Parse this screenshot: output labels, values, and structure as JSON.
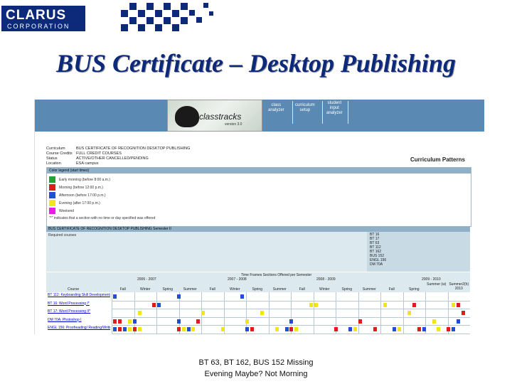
{
  "header": {
    "logo_main": "CLARUS",
    "logo_sub": "CORPORATION",
    "slide_title": "BUS Certificate – Desktop Publishing"
  },
  "app": {
    "logo_word": "classtracks",
    "logo_version": "version 3.0",
    "nav": [
      {
        "line1": "class",
        "line2": "analyzer"
      },
      {
        "line1": "curriculum",
        "line2": "setup"
      },
      {
        "line1": "student",
        "line2": "input",
        "line3": "analyzer"
      }
    ],
    "info": {
      "curriculum_label": "Curriculum",
      "curriculum_value": "BUS CERTIFICATE OF RECOGNITION DESKTOP PUBLISHING",
      "credits_label": "Course Credits",
      "credits_value": "FULL CREDIT COURSES",
      "status_label": "Status",
      "status_value": "ACTIVE/OTHER CANCELLED/PENDING",
      "location_label": "Location",
      "location_value": "ESA campus"
    },
    "patterns_title": "Curriculum Patterns",
    "legend": {
      "header": "Color legend (start times)",
      "items": [
        {
          "label": "Early morning (before 8:00 a.m.)",
          "color": "#22a33a"
        },
        {
          "label": "Morning (before 12:00 p.m.)",
          "color": "#e01b1b"
        },
        {
          "label": "Afternoon (before 17:00 p.m.)",
          "color": "#1f4fd6"
        },
        {
          "label": "Evening (after 17:00 p.m.)",
          "color": "#f2e51b"
        },
        {
          "label": "Weekend",
          "color": "#e61ee6"
        }
      ],
      "note": "\"*\" indicates that a section with no time or day specified was offered"
    },
    "program_bar": "BUS CERTIFICATE OF RECOGNITION DESKTOP PUBLISHING Semester II",
    "required_label": "Required courses",
    "required_courses": [
      "BT 16",
      "BT 17",
      "BT 63",
      "BT 112",
      "BT 162",
      "BUS 152",
      "ENGL 156",
      "DM 70A"
    ],
    "schedule": {
      "time_frame_label": "Time Frames Sections Offered per Semester",
      "years": [
        "2006 - 2007",
        "2007 - 2008",
        "2008 - 2009",
        "2009 - 2010"
      ],
      "course_col": "Course",
      "terms": [
        "Fall",
        "Winter",
        "Spring",
        "Summer",
        "Fall",
        "Winter",
        "Spring",
        "Summer",
        "Fall",
        "Winter",
        "Spring",
        "Summer",
        "Fall",
        "Spring",
        "Summer (w)",
        "Summer2(h) 2010"
      ],
      "courses": [
        "BT 112: Keyboarding Skill Development",
        "BT 16: Word Processing I*",
        "BT 17: Word Processing II*",
        "DM 70A: Photoshop I",
        "ENGL 156: Proofreading/ Reading/Writing*"
      ],
      "cells": [
        [
          [
            0,
            "blue"
          ],
          [
            13,
            "blue"
          ],
          [
            26,
            "blue"
          ]
        ],
        [
          [
            8,
            "red"
          ],
          [
            9,
            "blue"
          ],
          [
            40,
            "yellow"
          ],
          [
            41,
            "yellow"
          ],
          [
            55,
            "yellow"
          ],
          [
            61,
            "red"
          ],
          [
            69,
            "yellow"
          ],
          [
            70,
            "red"
          ]
        ],
        [
          [
            5,
            "yellow"
          ],
          [
            18,
            "yellow"
          ],
          [
            30,
            "yellow"
          ],
          [
            60,
            "yellow"
          ],
          [
            71,
            "red"
          ]
        ],
        [
          [
            0,
            "red"
          ],
          [
            1,
            "red"
          ],
          [
            3,
            "yellow"
          ],
          [
            4,
            "blue"
          ],
          [
            13,
            "blue"
          ],
          [
            17,
            "red"
          ],
          [
            27,
            "yellow"
          ],
          [
            36,
            "blue"
          ],
          [
            50,
            "red"
          ],
          [
            65,
            "yellow"
          ],
          [
            70,
            "blue"
          ]
        ],
        [
          [
            0,
            "blue"
          ],
          [
            1,
            "red"
          ],
          [
            2,
            "blue"
          ],
          [
            3,
            "yellow"
          ],
          [
            4,
            "red"
          ],
          [
            5,
            "yellow"
          ],
          [
            13,
            "red"
          ],
          [
            14,
            "yellow"
          ],
          [
            15,
            "blue"
          ],
          [
            16,
            "yellow"
          ],
          [
            22,
            "yellow"
          ],
          [
            27,
            "blue"
          ],
          [
            28,
            "red"
          ],
          [
            33,
            "yellow"
          ],
          [
            35,
            "blue"
          ],
          [
            36,
            "red"
          ],
          [
            37,
            "yellow"
          ],
          [
            45,
            "red"
          ],
          [
            48,
            "blue"
          ],
          [
            49,
            "yellow"
          ],
          [
            53,
            "red"
          ],
          [
            57,
            "blue"
          ],
          [
            58,
            "yellow"
          ],
          [
            62,
            "red"
          ],
          [
            63,
            "blue"
          ],
          [
            66,
            "yellow"
          ],
          [
            68,
            "red"
          ],
          [
            69,
            "blue"
          ]
        ]
      ],
      "color_map": {
        "red": "#e01b1b",
        "blue": "#1f4fd6",
        "yellow": "#f2e51b",
        "green": "#22a33a",
        "magenta": "#e61ee6"
      }
    }
  },
  "caption": {
    "line1": "BT 63, BT 162, BUS 152 Missing",
    "line2": "Evening Maybe? Not Morning"
  }
}
